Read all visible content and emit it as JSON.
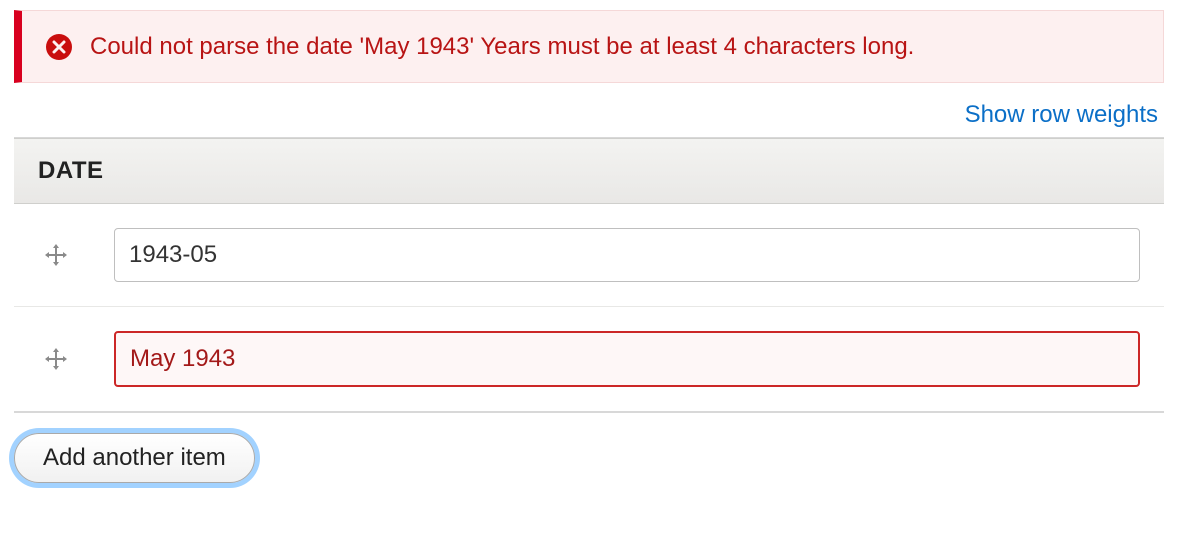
{
  "error": {
    "message": "Could not parse the date 'May 1943' Years must be at least 4 characters long."
  },
  "row_weights_link": "Show row weights",
  "table": {
    "header": "DATE",
    "rows": [
      {
        "value": "1943-05",
        "has_error": false
      },
      {
        "value": "May 1943",
        "has_error": true
      }
    ]
  },
  "add_button_label": "Add another item"
}
